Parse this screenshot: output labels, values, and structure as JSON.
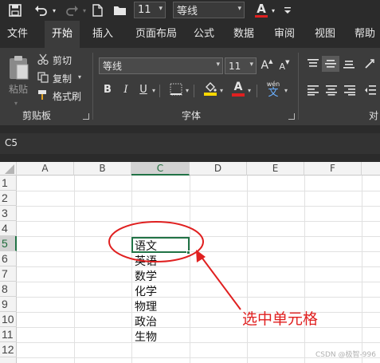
{
  "qat": {
    "font_size_value": "11",
    "font_name_value": "等线",
    "font_color_letter": "A"
  },
  "tabs": [
    {
      "label": "文件"
    },
    {
      "label": "开始",
      "active": true
    },
    {
      "label": "插入"
    },
    {
      "label": "页面布局"
    },
    {
      "label": "公式"
    },
    {
      "label": "数据"
    },
    {
      "label": "审阅"
    },
    {
      "label": "视图"
    },
    {
      "label": "帮助"
    }
  ],
  "clipboard": {
    "paste_label": "粘贴",
    "cut_label": "剪切",
    "copy_label": "复制",
    "format_painter_label": "格式刷",
    "group_label": "剪贴板"
  },
  "font_group": {
    "font_name_value": "等线",
    "font_size_value": "11",
    "grow_label": "A",
    "shrink_label": "A",
    "bold_label": "B",
    "italic_label": "I",
    "underline_label": "U",
    "font_color_letter": "A",
    "phonetic_label": "wén",
    "phonetic_char": "文",
    "group_label": "字体"
  },
  "align_group": {
    "group_label": "对"
  },
  "namebar": {
    "cell_reference": "C5"
  },
  "grid": {
    "columns": [
      "A",
      "B",
      "C",
      "D",
      "E",
      "F"
    ],
    "rows": [
      "1",
      "2",
      "3",
      "4",
      "5",
      "6",
      "7",
      "8",
      "9",
      "10",
      "11",
      "12"
    ],
    "selected_column": "C",
    "selected_row": "5",
    "column_c_values": [
      "",
      "",
      "",
      "",
      "语文",
      "英语",
      "数学",
      "化学",
      "物理",
      "政治",
      "生物",
      ""
    ]
  },
  "annotation": {
    "label": "选中单元格",
    "color": "#e02020"
  },
  "watermark": "CSDN @极智-996",
  "colors": {
    "ribbon_bg": "#3c3c3c",
    "titlebar_bg": "#2b2b2b",
    "selection_green": "#217346",
    "highlight_yellow": "#ffd800",
    "font_red": "#e02020"
  }
}
